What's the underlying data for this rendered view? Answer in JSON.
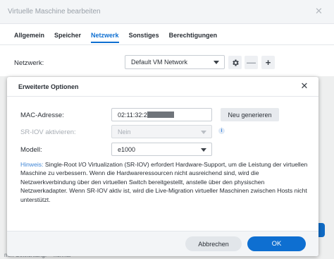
{
  "background": {
    "window_title": "Virtuelle Maschine bearbeiten",
    "tabs": [
      {
        "label": "Allgemein",
        "active": false
      },
      {
        "label": "Speicher",
        "active": false
      },
      {
        "label": "Netzwerk",
        "active": true
      },
      {
        "label": "Sonstiges",
        "active": false
      },
      {
        "label": "Berechtigungen",
        "active": false
      }
    ],
    "network_label": "Netzwerk:",
    "network_value": "Default VM Network",
    "bottom_label": "nen Gewichtung:",
    "bottom_value": "normal"
  },
  "dialog": {
    "title": "Erweiterte Optionen",
    "mac_label": "MAC-Adresse:",
    "mac_value": "02:11:32:2",
    "regenerate_label": "Neu generieren",
    "sriov_label": "SR-IOV aktivieren:",
    "sriov_value": "Nein",
    "model_label": "Modell:",
    "model_value": "e1000",
    "hint_key": "Hinweis:",
    "hint_text": "Single-Root I/O Virtualization (SR-IOV) erfordert Hardware-Support, um die Leistung der virtuellen Maschine zu verbessern. Wenn die Hardwareressourcen nicht ausreichend sind, wird die Netzwerkverbindung über den virtuellen Switch bereitgestellt, anstelle über den physischen Netzwerkadapter. Wenn SR-IOV aktiv ist, wird die Live-Migration virtueller Maschinen zwischen Hosts nicht unterstützt.",
    "cancel_label": "Abbrechen",
    "ok_label": "OK"
  },
  "colors": {
    "accent": "#0e6fd1",
    "hint_accent": "#3f86d6"
  },
  "icons": {
    "close": "close-icon",
    "settings": "gear-icon",
    "remove": "minus-icon",
    "add": "plus-icon",
    "info": "info-icon",
    "dropdown": "chevron-down-icon"
  }
}
